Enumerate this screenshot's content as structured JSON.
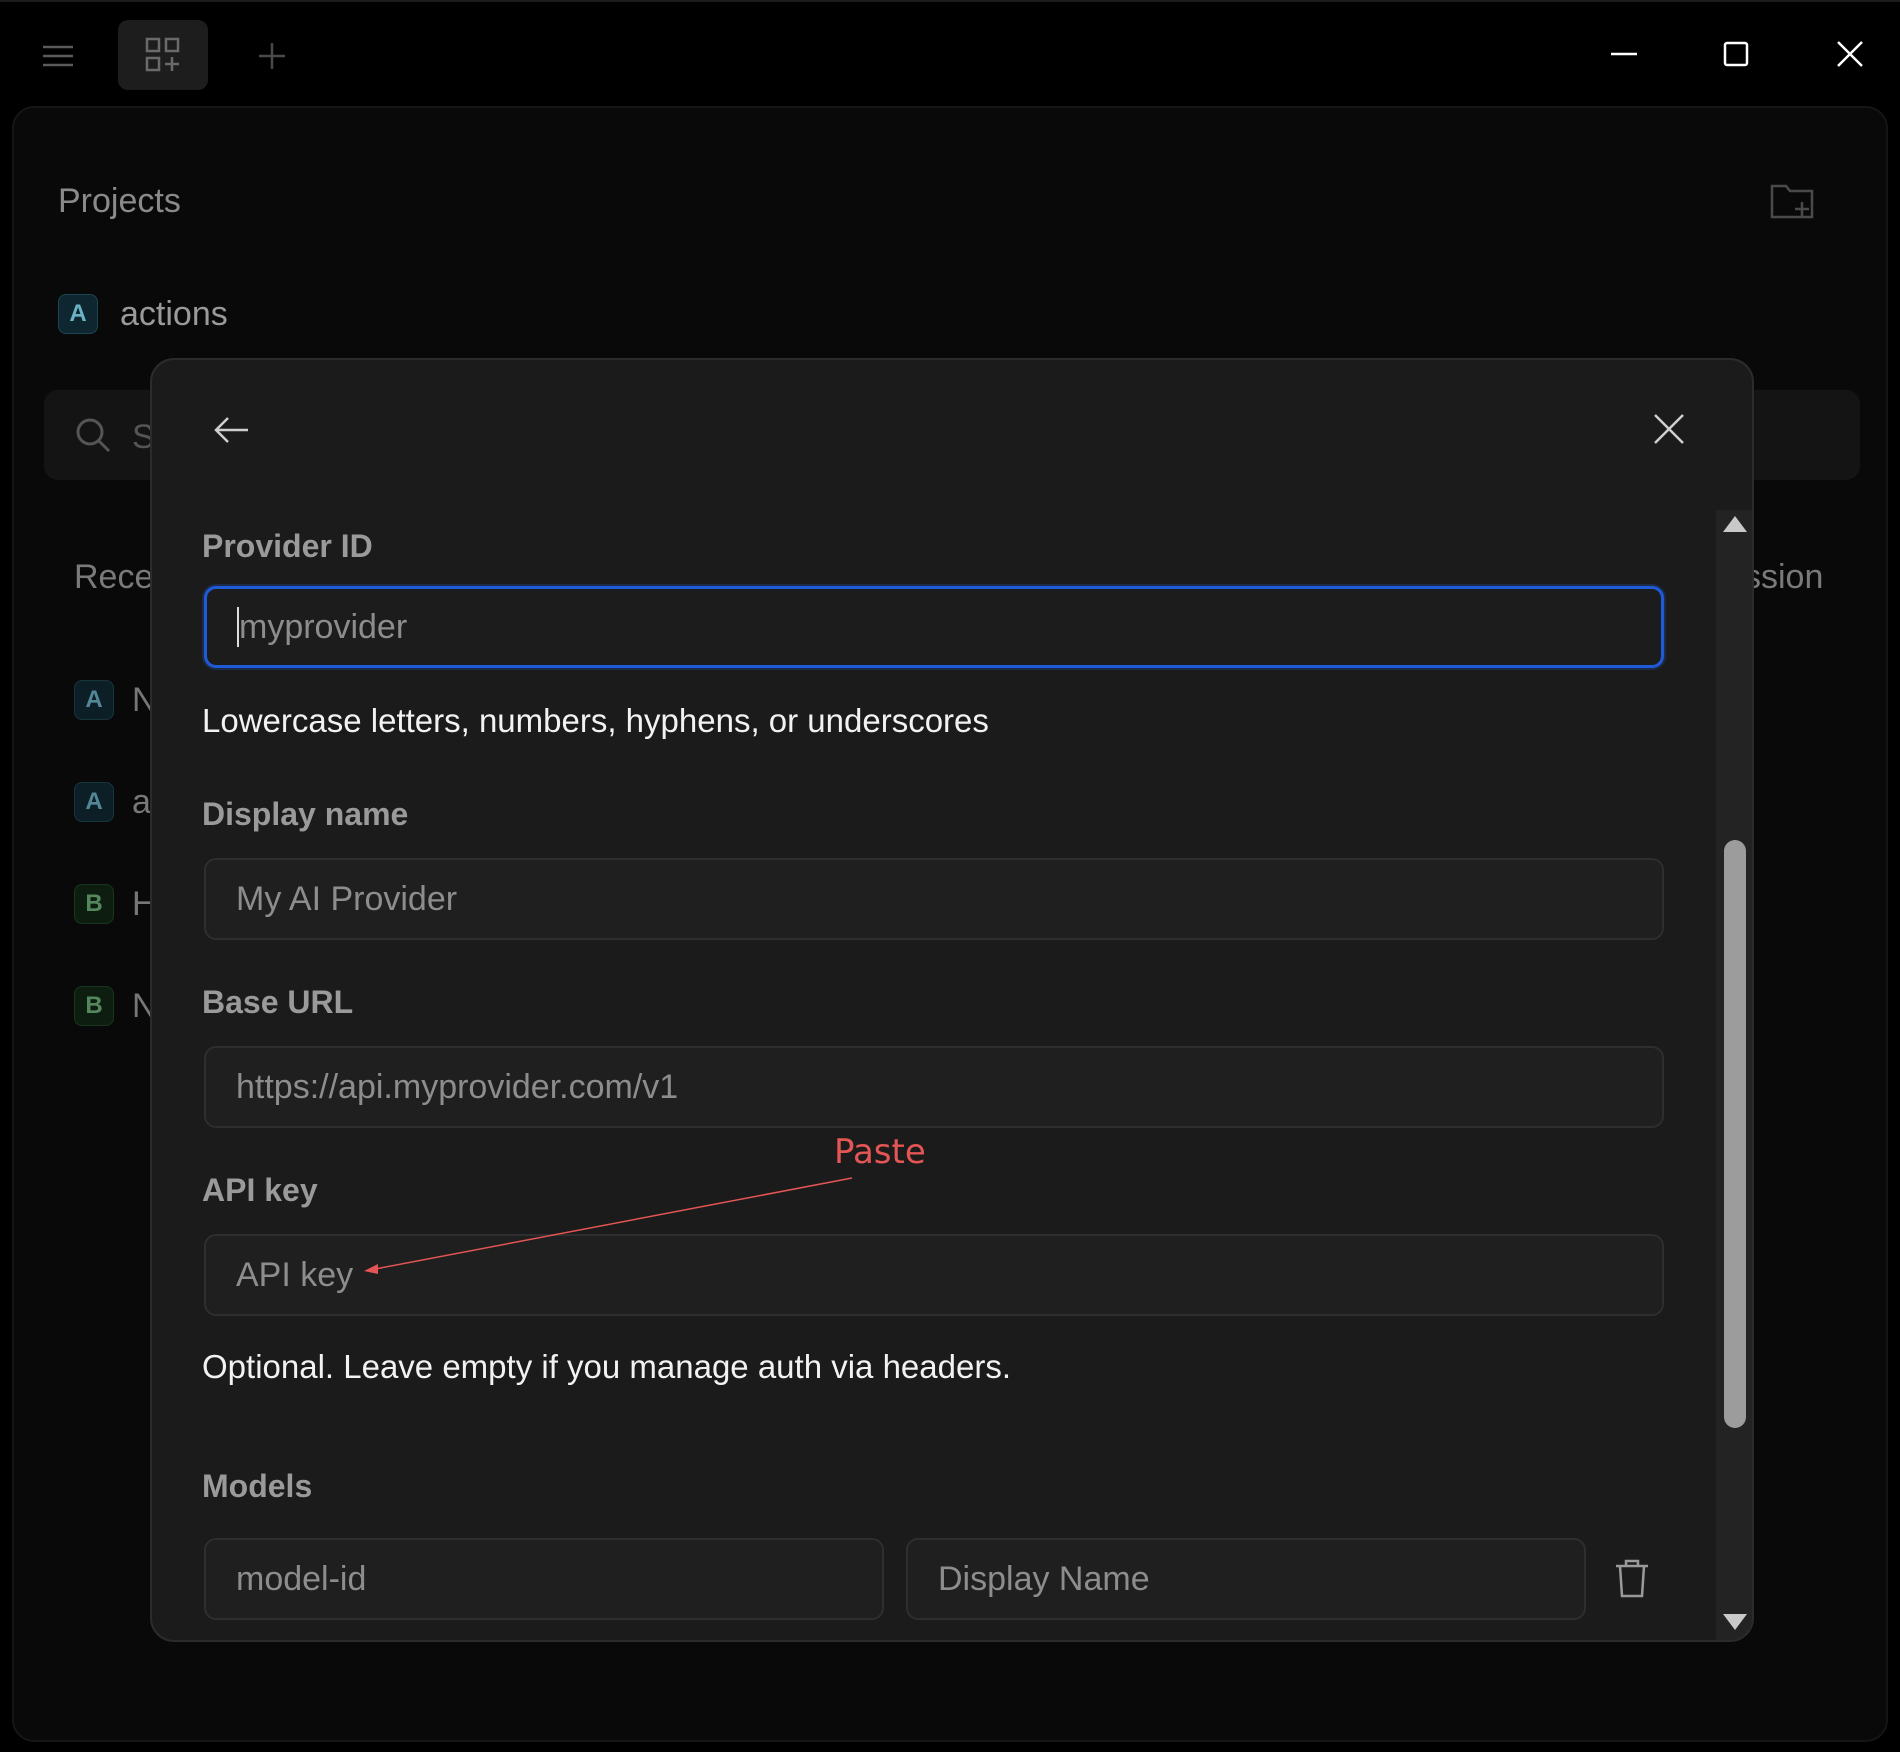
{
  "titlebar": {
    "icons": [
      "hamburger-menu-icon",
      "grid-plus-icon",
      "plus-icon",
      "minimize-icon",
      "maximize-icon",
      "close-icon"
    ]
  },
  "background": {
    "projects_title": "Projects",
    "new_folder_icon": "folder-plus-icon",
    "project": {
      "badge": "A",
      "name": "actions"
    },
    "search_peek": "S",
    "recent_peek": "Rece",
    "session_peek": "ssion",
    "recent_items": [
      {
        "badge": "A",
        "initial": "N",
        "kind": "a"
      },
      {
        "badge": "A",
        "initial": "a",
        "kind": "a"
      },
      {
        "badge": "B",
        "initial": "H",
        "kind": "b"
      },
      {
        "badge": "B",
        "initial": "N",
        "kind": "b"
      }
    ]
  },
  "modal": {
    "back_icon": "arrow-left-icon",
    "close_icon": "close-icon",
    "provider_id": {
      "label": "Provider ID",
      "placeholder": "myprovider",
      "helper": "Lowercase letters, numbers, hyphens, or underscores"
    },
    "display_name": {
      "label": "Display name",
      "placeholder": "My AI Provider"
    },
    "base_url": {
      "label": "Base URL",
      "placeholder": "https://api.myprovider.com/v1"
    },
    "api_key": {
      "label": "API key",
      "placeholder": "API key",
      "helper": "Optional. Leave empty if you manage auth via headers."
    },
    "models": {
      "label": "Models",
      "id_placeholder": "model-id",
      "name_placeholder": "Display Name",
      "delete_icon": "trash-icon"
    }
  },
  "annotation": {
    "text": "Paste",
    "color": "#e45555"
  },
  "colors": {
    "focus_border": "#1f5bd6",
    "background": "#000000",
    "modal": "#1b1b1b"
  }
}
